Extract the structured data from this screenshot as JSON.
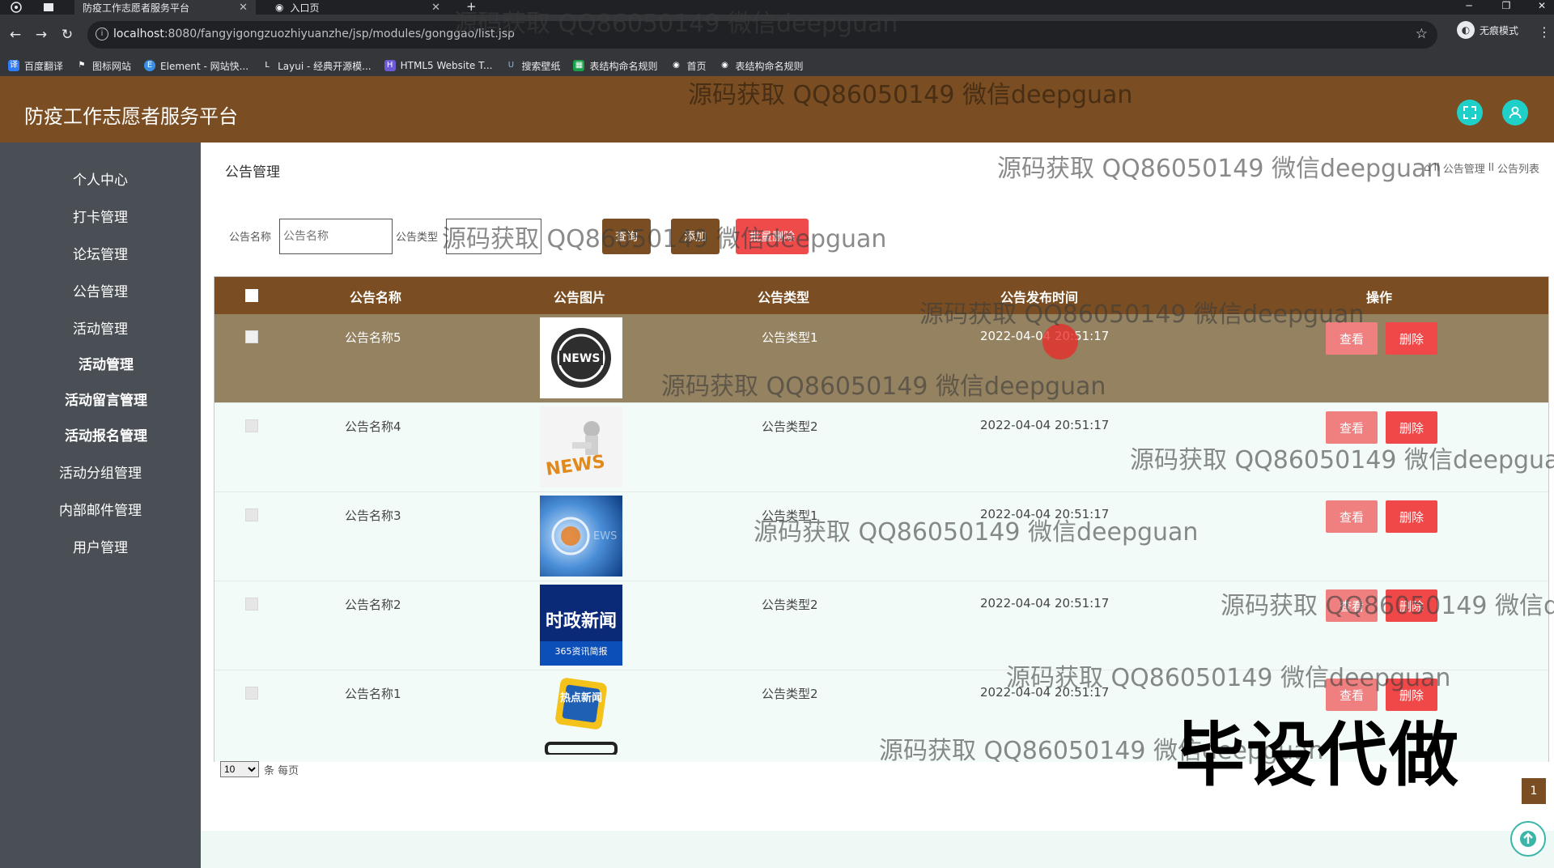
{
  "browser": {
    "tabs": [
      {
        "title": "防疫工作志愿者服务平台",
        "active": true
      },
      {
        "title": "入口页",
        "active": false
      }
    ],
    "url_host": "localhost",
    "url_rest": ":8080/fangyigongzuozhiyuanzhe/jsp/modules/gonggao/list.jsp",
    "incognito_label": "无痕模式",
    "bookmarks": [
      "百度翻译",
      "图标网站",
      "Element - 网站快...",
      "Layui - 经典开源模...",
      "HTML5 Website T...",
      "搜索壁纸",
      "表结构命名规则",
      "首页",
      "表结构命名规则"
    ]
  },
  "app": {
    "title": "防疫工作志愿者服务平台"
  },
  "sidebar": {
    "items": [
      "个人中心",
      "打卡管理",
      "论坛管理",
      "公告管理",
      "活动管理",
      "活动管理",
      "活动留言管理",
      "活动报名管理",
      "活动分组管理",
      "内部邮件管理",
      "用户管理"
    ]
  },
  "main": {
    "page_title": "公告管理",
    "breadcrumb": [
      "公告管理",
      "公告列表"
    ],
    "filters": {
      "name_label": "公告名称",
      "name_placeholder": "公告名称",
      "type_label": "公告类型",
      "search_label": "查询",
      "add_label": "添加",
      "delete_label": "批量删除"
    },
    "table": {
      "columns": [
        "公告名称",
        "公告图片",
        "公告类型",
        "公告发布时间",
        "操作"
      ],
      "view_label": "查看",
      "delete_label": "删除",
      "rows": [
        {
          "name": "公告名称5",
          "type": "公告类型1",
          "time": "2022-04-04 20:51:17",
          "image": "news-globe"
        },
        {
          "name": "公告名称4",
          "type": "公告类型2",
          "time": "2022-04-04 20:51:17",
          "image": "news-figure"
        },
        {
          "name": "公告名称3",
          "type": "公告类型1",
          "time": "2022-04-04 20:51:17",
          "image": "news-blue"
        },
        {
          "name": "公告名称2",
          "type": "公告类型2",
          "time": "2022-04-04 20:51:17",
          "image": "news-politics"
        },
        {
          "name": "公告名称1",
          "type": "公告类型2",
          "time": "2022-04-04 20:51:17",
          "image": "news-hot"
        }
      ]
    },
    "pagination": {
      "page_size": "10",
      "per_page_label": "条 每页",
      "current_page": "1"
    }
  },
  "thumb_text": {
    "news_globe": "NEWS",
    "news_figure": "NEWS",
    "news_politics": "时政新闻",
    "news_politics_sub": "365资讯简报",
    "news_hot": "热点新闻"
  },
  "watermarks": {
    "text": "源码获取 QQ86050149 微信deepguan",
    "big": "毕设代做"
  },
  "colors": {
    "brand": "#7a4e22",
    "sidebar": "#4a4f55",
    "danger": "#ef4b4b",
    "teal": "#1fd0c8"
  }
}
